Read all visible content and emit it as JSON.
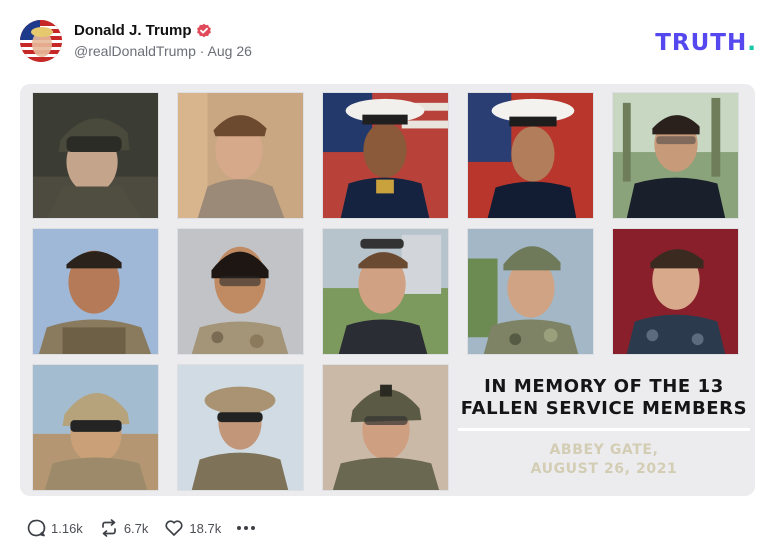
{
  "post": {
    "author_name": "Donald J. Trump",
    "handle": "@realDonaldTrump",
    "separator": "·",
    "date": "Aug 26"
  },
  "brand": {
    "logo_text": "TRUTH",
    "logo_dot": ".",
    "accent": "#5448ee",
    "dot_color": "#16c8a8",
    "verified_color": "#e04a5a"
  },
  "image": {
    "title_line1": "IN MEMORY OF THE 13",
    "title_line2": "FALLEN SERVICE MEMBERS",
    "subtitle_line1": "ABBEY GATE,",
    "subtitle_line2": "AUGUST 26, 2021",
    "portraits": [
      "combat-helmet-portrait",
      "casual-portrait",
      "dress-blues-portrait",
      "dress-blues-portrait",
      "dress-blues-portrait",
      "combat-gear-portrait",
      "camouflage-uniform-portrait",
      "casual-portrait",
      "camouflage-uniform-portrait",
      "casual-portrait",
      "combat-helmet-portrait",
      "combat-helmet-portrait",
      "combat-helmet-portrait"
    ]
  },
  "actions": {
    "replies": "1.16k",
    "retruths": "6.7k",
    "likes": "18.7k",
    "more_icon": "ellipsis-icon"
  }
}
